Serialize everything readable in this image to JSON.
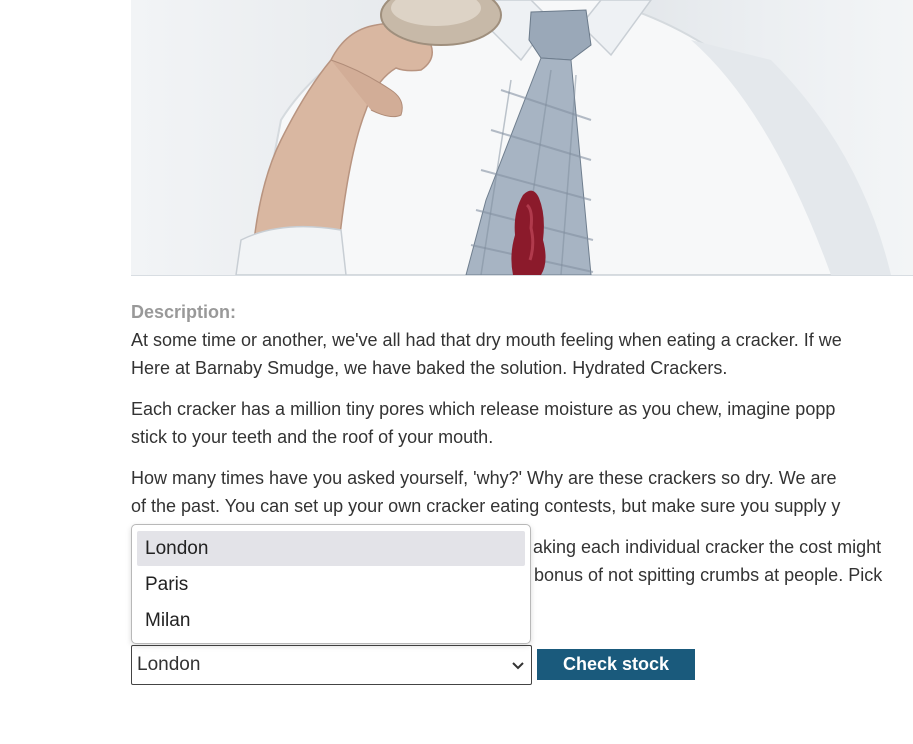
{
  "product": {
    "image_alt": "Man eating a cracker with a jam stain on his tie"
  },
  "description": {
    "heading": "Description:",
    "paragraphs": [
      [
        "At some time or another, we've all had that dry mouth feeling when eating a cracker. If we",
        "Here at Barnaby Smudge, we have baked the solution. Hydrated Crackers."
      ],
      [
        "Each cracker has a million tiny pores which release moisture as you chew, imagine popp",
        "stick to your teeth and the roof of your mouth."
      ],
      [
        "How many times have you asked yourself, 'why?' Why are these crackers so dry. We are",
        "of the past. You can set up your own cracker eating contests, but make sure you supply y"
      ],
      [
        "aking each individual cracker the cost might",
        "bonus of not spitting crumbs at people. Pick"
      ]
    ]
  },
  "stock_check": {
    "selected_store": "London",
    "options": [
      "London",
      "Paris",
      "Milan"
    ],
    "button_label": "Check stock"
  },
  "colors": {
    "button_bg": "#1a5a7c",
    "heading_gray": "#999999",
    "option_highlight": "#e3e3e8"
  }
}
